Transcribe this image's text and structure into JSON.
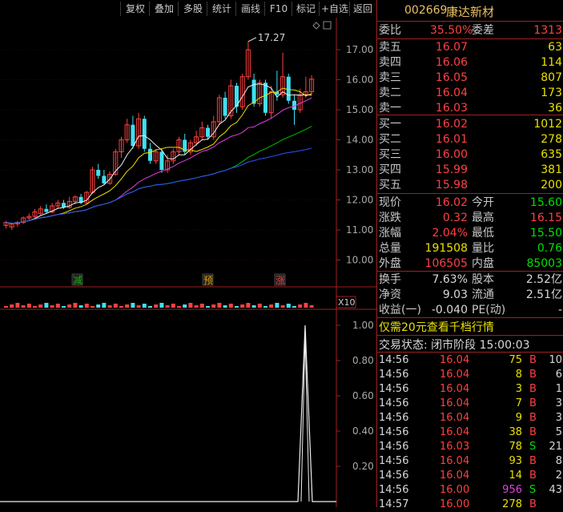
{
  "toolbar": {
    "buttons": [
      "复权",
      "叠加",
      "多股",
      "统计",
      "画线",
      "F10",
      "标记",
      "+自选",
      "返回"
    ]
  },
  "chart": {
    "price_axis": [
      "17.00",
      "16.00",
      "15.00",
      "14.00",
      "13.00",
      "12.00",
      "11.00",
      "10.00"
    ],
    "max_label": "17.27",
    "markers": {
      "jian": "减",
      "yu": "预",
      "zhang": "涨"
    },
    "vol_label": "X10",
    "indicator_axis": [
      "1.00",
      "0.80",
      "0.60",
      "0.40",
      "0.20"
    ],
    "candles": [
      [
        0,
        11.15,
        11.25,
        11.05,
        11.3
      ],
      [
        1,
        11.1,
        11.2,
        11.0,
        11.25
      ],
      [
        2,
        11.2,
        11.25,
        11.1,
        11.3
      ],
      [
        3,
        11.25,
        11.4,
        11.2,
        11.45
      ],
      [
        4,
        11.4,
        11.45,
        11.3,
        11.55
      ],
      [
        5,
        11.45,
        11.6,
        11.4,
        11.7
      ],
      [
        6,
        11.55,
        11.7,
        11.5,
        11.8
      ],
      [
        7,
        11.7,
        11.6,
        11.55,
        11.85
      ],
      [
        8,
        11.6,
        11.8,
        11.55,
        11.9
      ],
      [
        9,
        11.8,
        11.9,
        11.7,
        12.0
      ],
      [
        10,
        11.9,
        11.75,
        11.7,
        12.0
      ],
      [
        11,
        11.75,
        11.95,
        11.7,
        12.1
      ],
      [
        12,
        11.95,
        12.1,
        11.85,
        12.15
      ],
      [
        13,
        12.1,
        11.9,
        11.85,
        12.2
      ],
      [
        14,
        11.9,
        12.25,
        11.85,
        12.3
      ],
      [
        15,
        12.25,
        13.0,
        12.2,
        13.1
      ],
      [
        16,
        13.0,
        12.8,
        12.7,
        13.2
      ],
      [
        17,
        12.8,
        12.55,
        12.5,
        13.0
      ],
      [
        18,
        12.55,
        12.85,
        12.5,
        12.95
      ],
      [
        19,
        12.85,
        13.6,
        12.8,
        13.7
      ],
      [
        20,
        13.6,
        14.0,
        13.4,
        14.1
      ],
      [
        21,
        14.0,
        14.5,
        13.9,
        14.7
      ],
      [
        22,
        14.5,
        13.8,
        13.7,
        14.8
      ],
      [
        23,
        13.8,
        14.7,
        13.7,
        14.9
      ],
      [
        24,
        14.7,
        13.7,
        13.6,
        14.8
      ],
      [
        25,
        13.7,
        13.3,
        13.2,
        13.9
      ],
      [
        26,
        13.3,
        13.6,
        13.2,
        13.7
      ],
      [
        27,
        13.6,
        13.0,
        12.9,
        13.7
      ],
      [
        28,
        13.0,
        13.3,
        12.9,
        13.5
      ],
      [
        29,
        13.3,
        13.6,
        13.2,
        13.7
      ],
      [
        30,
        13.6,
        14.0,
        13.5,
        14.1
      ],
      [
        31,
        14.0,
        13.6,
        13.5,
        14.2
      ],
      [
        32,
        13.6,
        13.9,
        13.5,
        14.0
      ],
      [
        33,
        13.9,
        14.1,
        13.8,
        14.3
      ],
      [
        34,
        14.1,
        14.4,
        14.0,
        14.6
      ],
      [
        35,
        14.4,
        14.1,
        14.0,
        14.5
      ],
      [
        36,
        14.1,
        14.6,
        14.0,
        14.8
      ],
      [
        37,
        14.6,
        15.4,
        14.5,
        15.5
      ],
      [
        38,
        15.4,
        14.8,
        14.7,
        15.6
      ],
      [
        39,
        14.8,
        15.8,
        14.7,
        16.0
      ],
      [
        40,
        15.8,
        15.1,
        14.9,
        15.9
      ],
      [
        41,
        15.1,
        16.1,
        15.0,
        16.2
      ],
      [
        42,
        16.1,
        17.0,
        16.0,
        17.27
      ],
      [
        43,
        16.0,
        15.2,
        15.1,
        16.2
      ],
      [
        44,
        15.2,
        15.9,
        15.1,
        16.0
      ],
      [
        45,
        15.9,
        14.9,
        14.8,
        16.0
      ],
      [
        46,
        14.9,
        15.6,
        14.7,
        15.8
      ],
      [
        47,
        15.6,
        15.5,
        15.3,
        16.3
      ],
      [
        48,
        15.5,
        16.1,
        15.4,
        16.9
      ],
      [
        49,
        16.1,
        15.3,
        15.2,
        16.2
      ],
      [
        50,
        15.3,
        15.0,
        14.5,
        15.5
      ],
      [
        51,
        15.0,
        15.5,
        14.9,
        15.7
      ],
      [
        52,
        15.5,
        15.6,
        15.4,
        16.1
      ],
      [
        53,
        15.6,
        16.02,
        15.5,
        16.15
      ]
    ]
  },
  "quote": {
    "code": "002669",
    "name": "康达新材",
    "weibi_label": "委比",
    "weibi": "35.50%",
    "weicha_label": "委差",
    "weicha": "1313",
    "asks": [
      {
        "label": "卖五",
        "price": "16.07",
        "vol": "63"
      },
      {
        "label": "卖四",
        "price": "16.06",
        "vol": "114"
      },
      {
        "label": "卖三",
        "price": "16.05",
        "vol": "807"
      },
      {
        "label": "卖二",
        "price": "16.04",
        "vol": "173"
      },
      {
        "label": "卖一",
        "price": "16.03",
        "vol": "36"
      }
    ],
    "bids": [
      {
        "label": "买一",
        "price": "16.02",
        "vol": "1012"
      },
      {
        "label": "买二",
        "price": "16.01",
        "vol": "278"
      },
      {
        "label": "买三",
        "price": "16.00",
        "vol": "635"
      },
      {
        "label": "买四",
        "price": "15.99",
        "vol": "381"
      },
      {
        "label": "买五",
        "price": "15.98",
        "vol": "200"
      }
    ],
    "stats": [
      {
        "l1": "现价",
        "v1": "16.02",
        "l2": "今开",
        "v2": "15.60",
        "c1": "red",
        "c2": "green"
      },
      {
        "l1": "涨跌",
        "v1": "0.32",
        "l2": "最高",
        "v2": "16.15",
        "c1": "red",
        "c2": "red"
      },
      {
        "l1": "涨幅",
        "v1": "2.04%",
        "l2": "最低",
        "v2": "15.50",
        "c1": "red",
        "c2": "green"
      },
      {
        "l1": "总量",
        "v1": "191508",
        "l2": "量比",
        "v2": "0.76",
        "c1": "yellow",
        "c2": "green"
      },
      {
        "l1": "外盘",
        "v1": "106505",
        "l2": "内盘",
        "v2": "85003",
        "c1": "red",
        "c2": "green"
      }
    ],
    "stats2": [
      {
        "l1": "换手",
        "v1": "7.63%",
        "l2": "股本",
        "v2": "2.52亿"
      },
      {
        "l1": "净资",
        "v1": "9.03",
        "l2": "流通",
        "v2": "2.51亿"
      },
      {
        "l1": "收益(一)",
        "v1": "-0.040",
        "l2": "PE(动)",
        "v2": "-"
      }
    ],
    "ad": "仅需20元查看千档行情",
    "state_label": "交易状态: 闭市阶段",
    "state_time": "15:00:03"
  },
  "ticks": [
    {
      "t": "14:56",
      "p": "16.04",
      "v": "75",
      "s": "B",
      "n": "10"
    },
    {
      "t": "14:56",
      "p": "16.04",
      "v": "8",
      "s": "B",
      "n": "6"
    },
    {
      "t": "14:56",
      "p": "16.04",
      "v": "3",
      "s": "B",
      "n": "1"
    },
    {
      "t": "14:56",
      "p": "16.04",
      "v": "7",
      "s": "B",
      "n": "3"
    },
    {
      "t": "14:56",
      "p": "16.04",
      "v": "9",
      "s": "B",
      "n": "3"
    },
    {
      "t": "14:56",
      "p": "16.04",
      "v": "38",
      "s": "B",
      "n": "5"
    },
    {
      "t": "14:56",
      "p": "16.03",
      "v": "78",
      "s": "S",
      "n": "21"
    },
    {
      "t": "14:56",
      "p": "16.04",
      "v": "93",
      "b": true,
      "s": "B",
      "n": "8"
    },
    {
      "t": "14:56",
      "p": "16.04",
      "v": "14",
      "s": "B",
      "n": "2"
    },
    {
      "t": "14:56",
      "p": "16.00",
      "v": "956",
      "purple": true,
      "s": "S",
      "n": "43"
    },
    {
      "t": "14:57",
      "p": "16.00",
      "v": "278",
      "s": "B",
      "n": ""
    }
  ]
}
